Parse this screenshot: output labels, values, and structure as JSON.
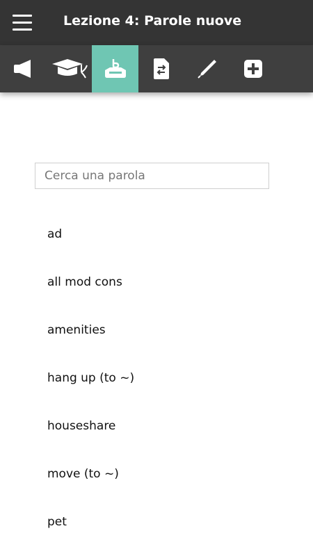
{
  "header": {
    "title": "Lezione 4: Parole nuove",
    "menu_icon": "hamburger-menu-icon"
  },
  "toolbar": {
    "active_color": "#6fc6b3",
    "tabs": [
      {
        "icon": "speaker-icon",
        "active": false
      },
      {
        "icon": "graduation-cap-icon",
        "active": false
      },
      {
        "icon": "vocabulary-box-icon",
        "active": true
      },
      {
        "icon": "document-swap-icon",
        "active": false
      },
      {
        "icon": "pen-icon",
        "active": false
      },
      {
        "icon": "plus-icon",
        "active": false
      }
    ]
  },
  "search": {
    "placeholder": "Cerca una parola",
    "value": ""
  },
  "words": [
    "ad",
    "all mod cons",
    "amenities",
    "hang up (to ~)",
    "houseshare",
    "move (to ~)",
    "pet"
  ]
}
